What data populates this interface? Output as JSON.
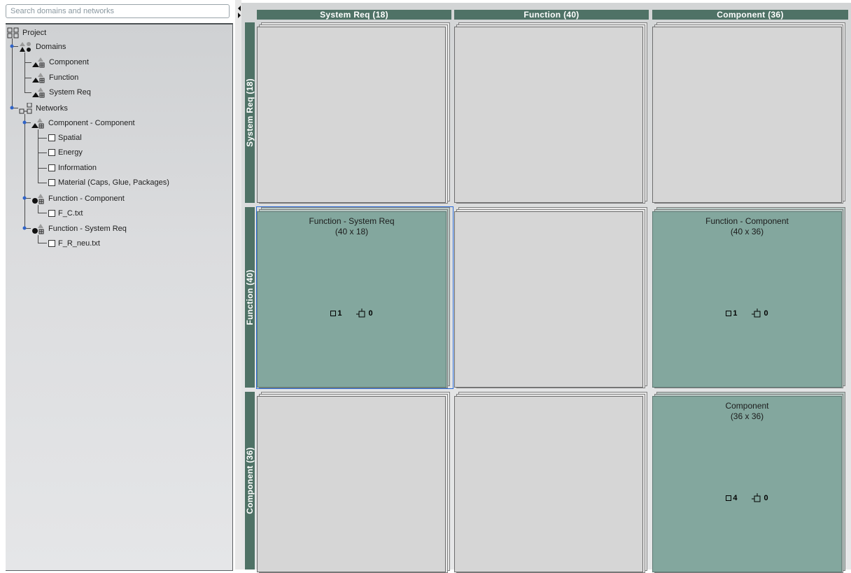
{
  "search": {
    "placeholder": "Search domains and networks"
  },
  "tree": {
    "project": "Project",
    "domains": "Domains",
    "domain_items": [
      "Component",
      "Function",
      "System Req"
    ],
    "networks": "Networks",
    "net_cc": "Component - Component",
    "net_cc_items": [
      "Spatial",
      "Energy",
      "Information",
      "Material (Caps, Glue, Packages)"
    ],
    "net_fc": "Function - Component",
    "net_fc_items": [
      "F_C.txt"
    ],
    "net_fs": "Function - System Req",
    "net_fs_items": [
      "F_R_neu.txt"
    ]
  },
  "matrix": {
    "columns": [
      "System Req (18)",
      "Function (40)",
      "Component (36)"
    ],
    "rows": [
      "System Req (18)",
      "Function (40)",
      "Component (36)"
    ],
    "cells": {
      "fs": {
        "title": "Function - System Req",
        "dims": "(40 x 18)",
        "nodes": "1",
        "edges": "0"
      },
      "fc": {
        "title": "Function - Component",
        "dims": "(40 x 36)",
        "nodes": "1",
        "edges": "0"
      },
      "cc": {
        "title": "Component",
        "dims": "(36 x 36)",
        "nodes": "4",
        "edges": "0"
      }
    }
  },
  "colors": {
    "header": "#4f7266",
    "active_cell": "#83a79e",
    "empty_cell": "#d6d6d6",
    "selection": "#2a6ad8"
  }
}
